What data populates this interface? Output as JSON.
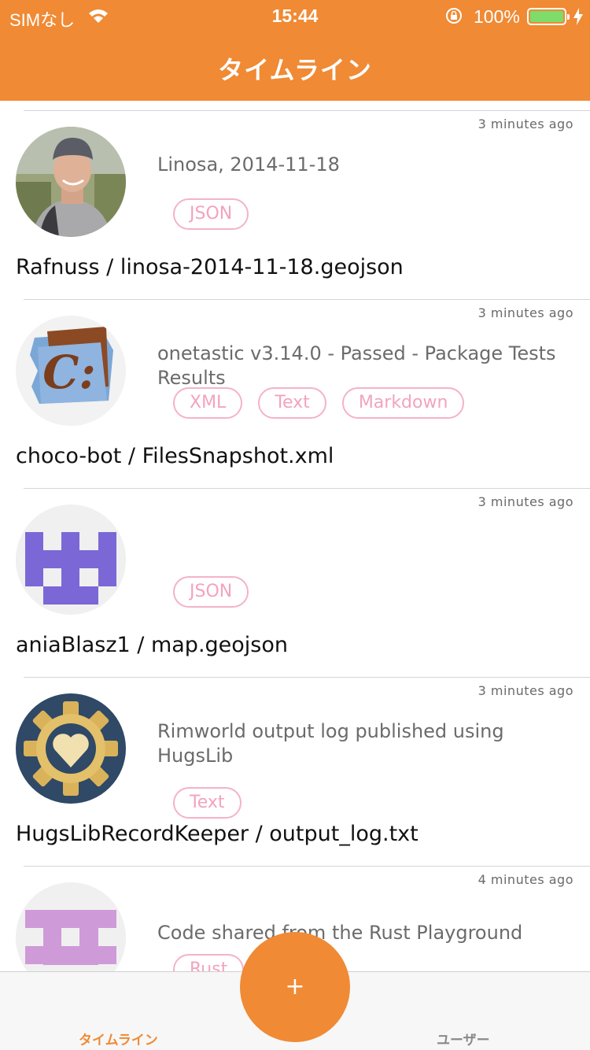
{
  "status": {
    "carrier": "SIMなし",
    "time": "15:44",
    "battery_pct": "100%"
  },
  "nav": {
    "title": "タイムライン"
  },
  "feed": [
    {
      "time": "3 minutes ago",
      "description": "Linosa, 2014-11-18",
      "tags": [
        "JSON"
      ],
      "title": "Rafnuss / linosa-2014-11-18.geojson",
      "avatar": "user-photo-avatar"
    },
    {
      "time": "3 minutes ago",
      "description": "onetastic v3.14.0 - Passed - Package Tests Results",
      "tags": [
        "XML",
        "Text",
        "Markdown"
      ],
      "title": "choco-bot / FilesSnapshot.xml",
      "avatar": "chocolatey-logo-avatar"
    },
    {
      "time": "3 minutes ago",
      "description": "",
      "tags": [
        "JSON"
      ],
      "title": "aniaBlasz1 / map.geojson",
      "avatar": "purple-identicon-avatar"
    },
    {
      "time": "3 minutes ago",
      "description": "Rimworld output log published using HugsLib",
      "tags": [
        "Text"
      ],
      "title": "HugsLibRecordKeeper / output_log.txt",
      "avatar": "gear-heart-avatar"
    },
    {
      "time": "4 minutes ago",
      "description": "Code shared from the Rust Playground",
      "tags": [
        "Rust"
      ],
      "title": "",
      "avatar": "lilac-identicon-avatar"
    }
  ],
  "fab": {
    "label": "+"
  },
  "tabs": {
    "timeline": "タイムライン",
    "users": "ユーザー"
  },
  "colors": {
    "accent": "#f08a34",
    "tag_border": "#f4b3c7",
    "tag_text": "#f3a3be"
  }
}
